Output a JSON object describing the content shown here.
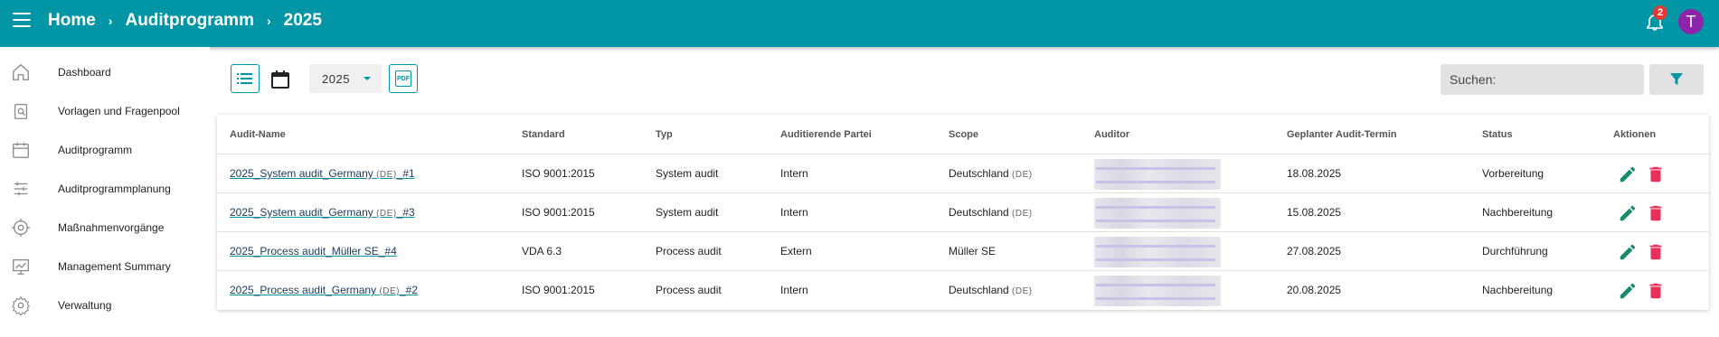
{
  "header": {
    "breadcrumbs": [
      "Home",
      "Auditprogramm",
      "2025"
    ],
    "notification_count": "2",
    "avatar_initial": "T"
  },
  "sidebar": {
    "items": [
      {
        "label": "Dashboard",
        "icon": "home-icon"
      },
      {
        "label": "Vorlagen und Fragenpool",
        "icon": "clipboard-icon"
      },
      {
        "label": "Auditprogramm",
        "icon": "calendar-icon"
      },
      {
        "label": "Auditprogrammplanung",
        "icon": "sliders-icon"
      },
      {
        "label": "Maßnahmenvorgänge",
        "icon": "target-icon"
      },
      {
        "label": "Management Summary",
        "icon": "chart-icon"
      },
      {
        "label": "Verwaltung",
        "icon": "gear-icon"
      }
    ]
  },
  "toolbar": {
    "year_value": "2025",
    "pdf_label": "PDF",
    "search_placeholder": "Suchen:"
  },
  "table": {
    "columns": [
      "Audit-Name",
      "Standard",
      "Typ",
      "Auditierende Partei",
      "Scope",
      "Auditor",
      "Geplanter Audit-Termin",
      "Status",
      "Aktionen"
    ],
    "rows": [
      {
        "name_pre": "2025_System audit_Germany ",
        "name_flag": "(DE)",
        "name_post": "_#1",
        "standard": "ISO 9001:2015",
        "typ": "System audit",
        "partei": "Intern",
        "scope": "Deutschland ",
        "scope_flag": "(DE)",
        "termin": "18.08.2025",
        "status": "Vorbereitung"
      },
      {
        "name_pre": "2025_System audit_Germany ",
        "name_flag": "(DE)",
        "name_post": "_#3",
        "standard": "ISO 9001:2015",
        "typ": "System audit",
        "partei": "Intern",
        "scope": "Deutschland ",
        "scope_flag": "(DE)",
        "termin": "15.08.2025",
        "status": "Nachbereitung"
      },
      {
        "name_pre": "2025_Process audit_Müller SE_#4",
        "name_flag": "",
        "name_post": "",
        "standard": "VDA 6.3",
        "typ": "Process audit",
        "partei": "Extern",
        "scope": "Müller SE",
        "scope_flag": "",
        "termin": "27.08.2025",
        "status": "Durchführung"
      },
      {
        "name_pre": "2025_Process audit_Germany ",
        "name_flag": "(DE)",
        "name_post": "_#2",
        "standard": "ISO 9001:2015",
        "typ": "Process audit",
        "partei": "Intern",
        "scope": "Deutschland ",
        "scope_flag": "(DE)",
        "termin": "20.08.2025",
        "status": "Nachbereitung"
      }
    ]
  },
  "colors": {
    "primary": "#0096a6",
    "edit": "#1a8a6e",
    "delete": "#e8305a"
  }
}
